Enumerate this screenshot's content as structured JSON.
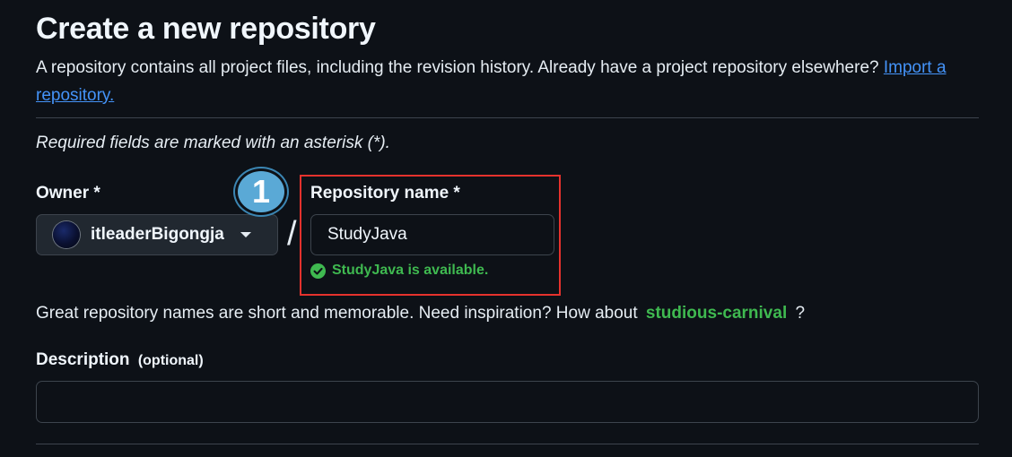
{
  "header": {
    "title": "Create a new repository",
    "intro_text": "A repository contains all project files, including the revision history. Already have a project repository elsewhere?",
    "import_link": "Import a repository."
  },
  "form": {
    "required_note": "Required fields are marked with an asterisk (*).",
    "owner": {
      "label": "Owner *",
      "value": "itleaderBigongja"
    },
    "separator": "/",
    "repository_name": {
      "label": "Repository name *",
      "value": "StudyJava",
      "status": "StudyJava is available."
    },
    "hint": {
      "text": "Great repository names are short and memorable. Need inspiration? How about",
      "suggestion": "studious-carnival",
      "end": "?"
    },
    "description": {
      "label": "Description",
      "optional": "(optional)",
      "value": ""
    }
  },
  "annotation": {
    "step_number": "1",
    "badge_color": "#5aa9d6",
    "box_color": "#e5322d"
  },
  "colors": {
    "background": "#0d1117",
    "link": "#4493f8",
    "success": "#3fb950"
  }
}
